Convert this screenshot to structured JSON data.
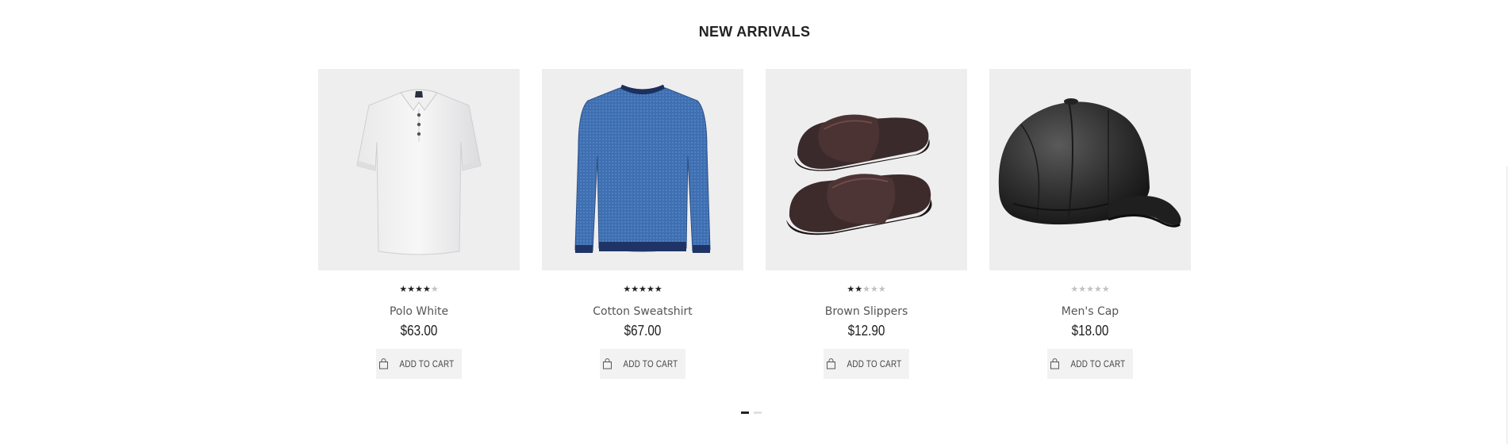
{
  "section": {
    "title": "NEW ARRIVALS"
  },
  "products": [
    {
      "name": "Polo White",
      "price": "$63.00",
      "rating": 4,
      "max_rating": 5,
      "image_icon": "polo-shirt-icon",
      "cart_label": "ADD TO CART"
    },
    {
      "name": "Cotton Sweatshirt",
      "price": "$67.00",
      "rating": 5,
      "max_rating": 5,
      "image_icon": "sweatshirt-icon",
      "cart_label": "ADD TO CART"
    },
    {
      "name": "Brown Slippers",
      "price": "$12.90",
      "rating": 2,
      "max_rating": 5,
      "image_icon": "slippers-icon",
      "cart_label": "ADD TO CART"
    },
    {
      "name": "Men's Cap",
      "price": "$18.00",
      "rating": 0,
      "max_rating": 5,
      "image_icon": "cap-icon",
      "cart_label": "ADD TO CART"
    }
  ],
  "carousel": {
    "pages": 2,
    "active_page": 1
  },
  "colors": {
    "thumb_bg": "#eeeeee",
    "star_on": "#222222",
    "star_off": "#c2c2c2",
    "button_bg": "#f2f2f2"
  }
}
